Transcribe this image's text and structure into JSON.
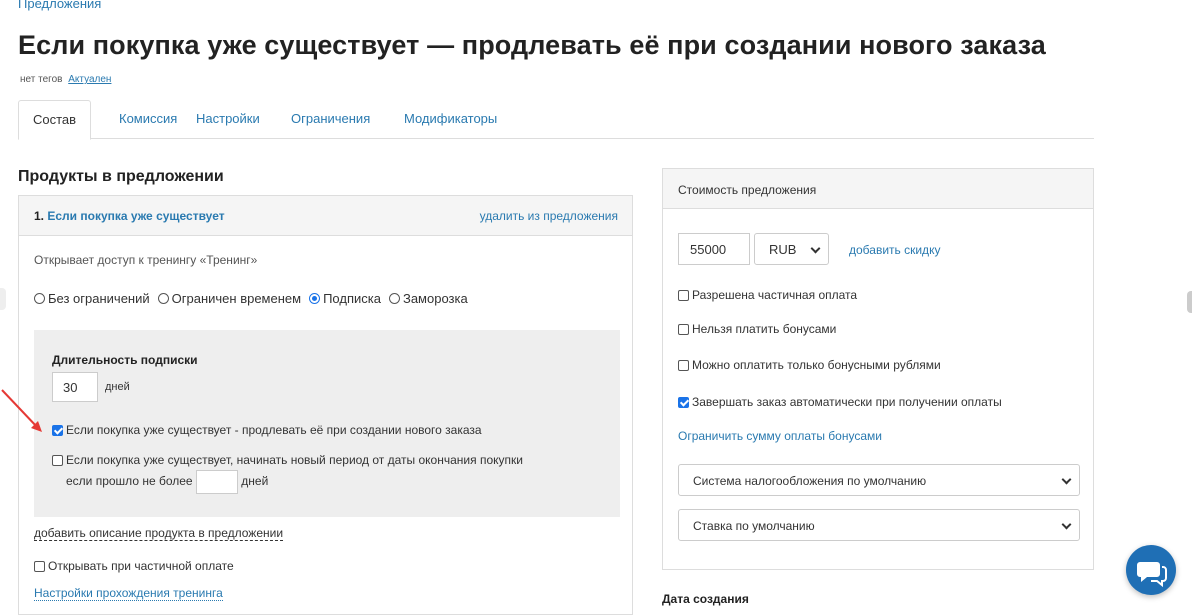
{
  "breadcrumb": "Предложения",
  "page_title": "Если покупка уже существует — продлевать её при создании нового заказа",
  "meta": {
    "tags": "нет тегов",
    "status": "Актуален"
  },
  "tabs": [
    {
      "label": "Состав",
      "active": true
    },
    {
      "label": "Комиссия",
      "active": false
    },
    {
      "label": "Настройки",
      "active": false
    },
    {
      "label": "Ограничения",
      "active": false
    },
    {
      "label": "Модификаторы",
      "active": false
    }
  ],
  "products": {
    "section_title": "Продукты в предложении",
    "item": {
      "number": "1.",
      "name": "Если покупка уже существует",
      "remove_label": "удалить из предложения",
      "access_text": "Открывает доступ к тренингу «Тренинг»",
      "radios": [
        {
          "label": "Без ограничений",
          "checked": false
        },
        {
          "label": "Ограничен временем",
          "checked": false
        },
        {
          "label": "Подписка",
          "checked": true
        },
        {
          "label": "Заморозка",
          "checked": false
        }
      ],
      "subscription": {
        "title": "Длительность подписки",
        "duration_value": "30",
        "duration_unit": "дней",
        "extend_checkbox": {
          "label": "Если покупка уже существует - продлевать её при создании нового заказа",
          "checked": true
        },
        "new_period_checkbox": {
          "label_line1": "Если покупка уже существует, начинать новый период от даты окончания покупки",
          "label_line2": "если прошло не более",
          "value": "",
          "unit": "дней",
          "checked": false
        }
      },
      "add_description": "добавить описание продукта в предложении",
      "partial_open": {
        "label": "Открывать при частичной оплате",
        "checked": false
      },
      "training_settings": "Настройки прохождения тренинга"
    }
  },
  "price": {
    "header": "Стоимость предложения",
    "amount": "55000",
    "currency": "RUB",
    "add_discount": "добавить скидку",
    "checkboxes": [
      {
        "label": "Разрешена частичная оплата",
        "checked": false
      },
      {
        "label": "Нельзя платить бонусами",
        "checked": false
      },
      {
        "label": "Можно оплатить только бонусными рублями",
        "checked": false
      },
      {
        "label": "Завершать заказ автоматически при получении оплаты",
        "checked": true
      }
    ],
    "limit_link": "Ограничить сумму оплаты бонусами",
    "tax_system": "Система налогообложения по умолчанию",
    "tax_rate": "Ставка по умолчанию"
  },
  "created_label": "Дата создания",
  "colors": {
    "link": "#2a7ab0",
    "accent": "#1a73e8",
    "chat": "#1f6fb5",
    "arrow": "#e53935"
  },
  "icons": {
    "chat": "chat-bubble-icon",
    "select": "chevron-down-icon",
    "annotation": "red-arrow-icon"
  }
}
